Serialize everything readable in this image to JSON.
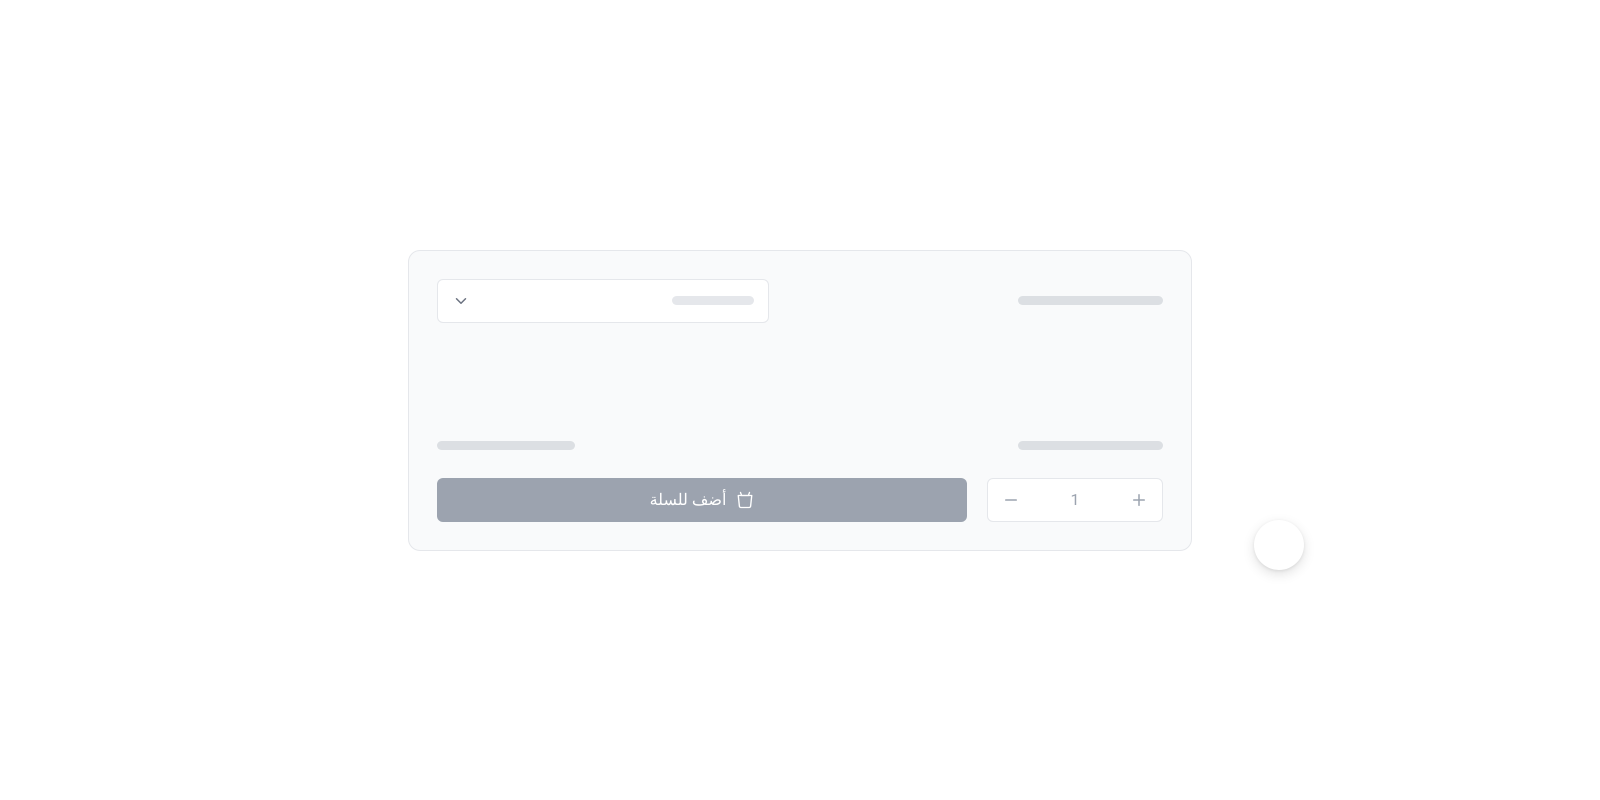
{
  "quantity": {
    "value": "1"
  },
  "add_to_cart": {
    "label": "أضف للسلة"
  }
}
